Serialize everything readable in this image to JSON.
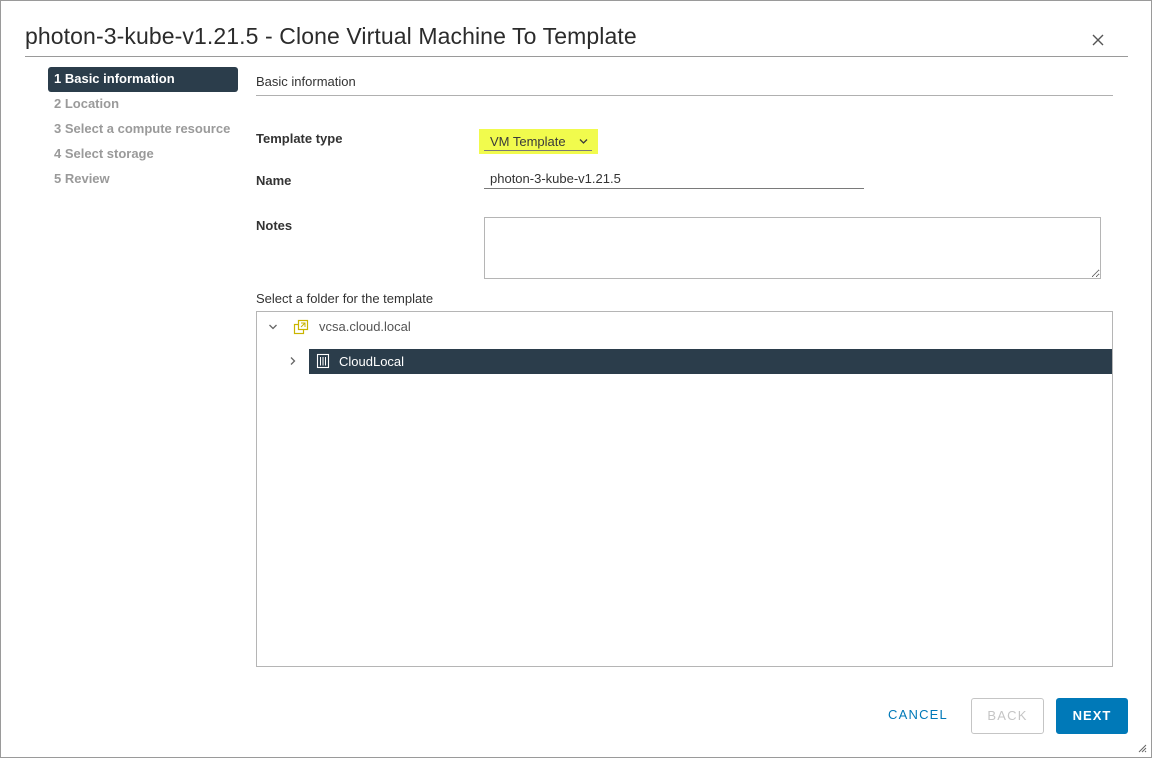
{
  "dialog": {
    "title": "photon-3-kube-v1.21.5 - Clone Virtual Machine To Template"
  },
  "steps": [
    {
      "label": "1 Basic information",
      "active": true
    },
    {
      "label": "2 Location",
      "active": false
    },
    {
      "label": "3 Select a compute resource",
      "active": false
    },
    {
      "label": "4 Select storage",
      "active": false
    },
    {
      "label": "5 Review",
      "active": false
    }
  ],
  "form": {
    "section_title": "Basic information",
    "template_type_label": "Template type",
    "template_type_value": "VM Template",
    "name_label": "Name",
    "name_value": "photon-3-kube-v1.21.5",
    "notes_label": "Notes",
    "notes_value": "",
    "folder_label": "Select a folder for the template"
  },
  "tree": {
    "root": {
      "label": "vcsa.cloud.local",
      "icon": "vcenter-icon",
      "expanded": true
    },
    "children": [
      {
        "label": "CloudLocal",
        "icon": "datacenter-icon",
        "expanded": false,
        "selected": true
      }
    ]
  },
  "footer": {
    "cancel_label": "CANCEL",
    "back_label": "BACK",
    "next_label": "NEXT"
  },
  "colors": {
    "accent": "#0079b8",
    "selected_bg": "#2b3d4b",
    "highlight": "#f1fb4d",
    "vcenter_icon": "#c9b400"
  }
}
